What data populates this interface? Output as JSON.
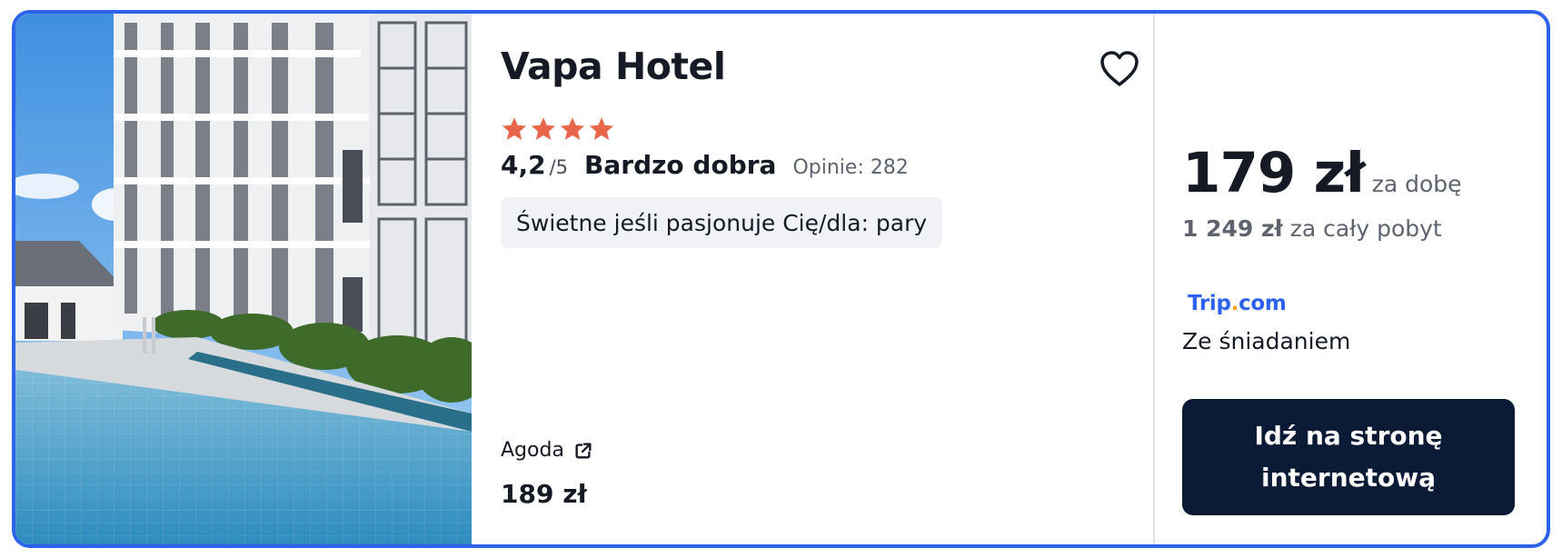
{
  "hotel": {
    "name": "Vapa Hotel",
    "star_count": 4,
    "rating_score": "4,2",
    "rating_max": "/5",
    "rating_verdict": "Bardzo dobra",
    "reviews": "Opinie: 282",
    "tag": "Świetne jeśli pasjonuje Cię/dla: pary"
  },
  "alt_offer": {
    "provider": "Agoda",
    "price": "189 zł"
  },
  "best_offer": {
    "price": "179 zł",
    "per_night": "za dobę",
    "total_amount": "1 249 zł",
    "total_label": " za cały pobyt",
    "site_name": "Trip",
    "site_dot": ".",
    "site_tld": "com",
    "meal": "Ze śniadaniem",
    "cta_label": "Idź na stronę internetową"
  },
  "icons": {
    "favorite": "heart-icon",
    "star": "star-icon",
    "external": "external-link-icon"
  },
  "colors": {
    "card_border": "#2d62ea",
    "star": "#e8664a",
    "cta_bg": "#0b1b36",
    "brand_blue": "#2d62ea",
    "brand_dot": "#f2a31b"
  }
}
